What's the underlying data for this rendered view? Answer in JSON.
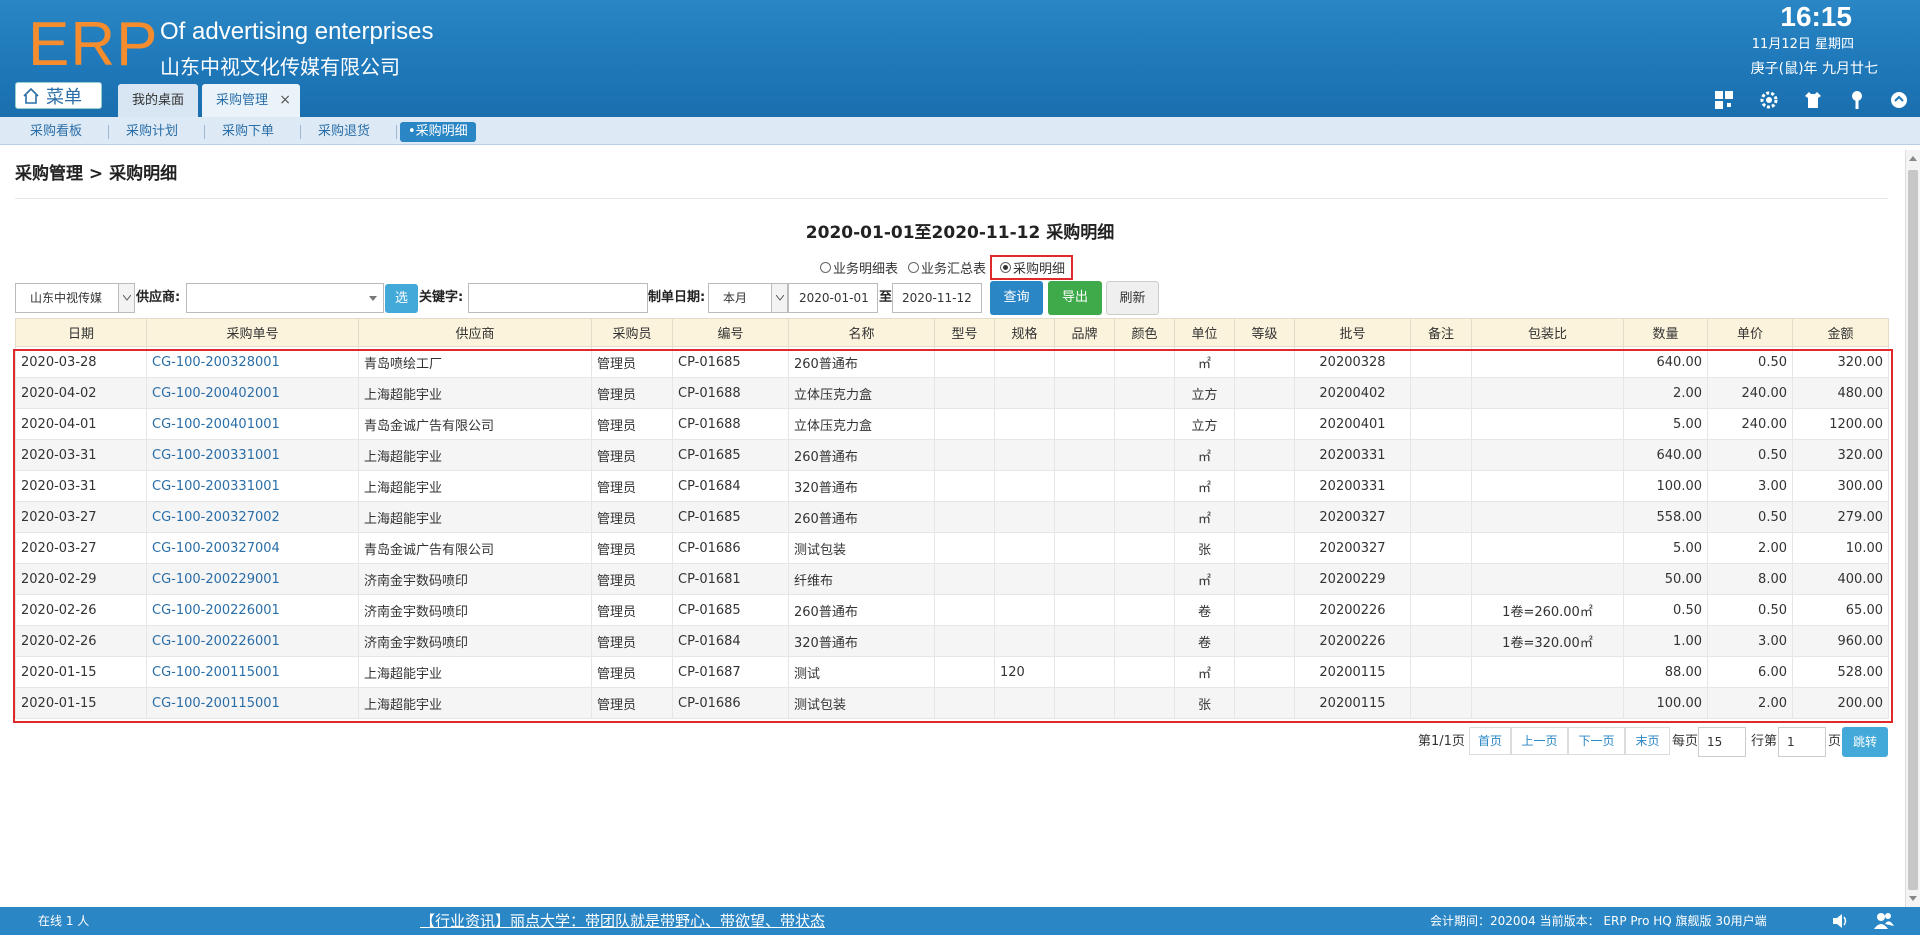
{
  "header": {
    "logo": "ERP",
    "company_en": "Of advertising enterprises",
    "company_cn": "山东中视文化传媒有限公司",
    "time": "16:15",
    "date": "11月12日 星期四",
    "lunar": "庚子(鼠)年 九月廿七",
    "menu_label": "菜单"
  },
  "tabs": [
    {
      "label": "我的桌面"
    },
    {
      "label": "采购管理",
      "close": "×"
    }
  ],
  "submenu": [
    "采购看板",
    "采购计划",
    "采购下单",
    "采购退货",
    "•采购明细"
  ],
  "breadcrumb": "采购管理 > 采购明细",
  "report_title": "2020-01-01至2020-11-12 采购明细",
  "report_types": [
    "业务明细表",
    "业务汇总表",
    "采购明细"
  ],
  "filters": {
    "company": "山东中视传媒",
    "supplier_label": "供应商:",
    "supplier_value": "",
    "choose_label": "选",
    "keyword_label": "关键字:",
    "keyword_value": "",
    "date_label": "制单日期:",
    "period": "本月",
    "date_from": "2020-01-01",
    "date_to_label": "至",
    "date_to": "2020-11-12",
    "query_label": "查询",
    "export_label": "导出",
    "refresh_label": "刷新"
  },
  "columns": [
    "日期",
    "采购单号",
    "供应商",
    "采购员",
    "编号",
    "名称",
    "型号",
    "规格",
    "品牌",
    "颜色",
    "单位",
    "等级",
    "批号",
    "备注",
    "包装比",
    "数量",
    "单价",
    "金额"
  ],
  "rows": [
    [
      "2020-03-28",
      "CG-100-200328001",
      "青岛喷绘工厂",
      "管理员",
      "CP-01685",
      "260普通布",
      "",
      "",
      "",
      "",
      "㎡",
      "",
      "20200328",
      "",
      "",
      "640.00",
      "0.50",
      "320.00"
    ],
    [
      "2020-04-02",
      "CG-100-200402001",
      "上海超能宇业",
      "管理员",
      "CP-01688",
      "立体压克力盒",
      "",
      "",
      "",
      "",
      "立方",
      "",
      "20200402",
      "",
      "",
      "2.00",
      "240.00",
      "480.00"
    ],
    [
      "2020-04-01",
      "CG-100-200401001",
      "青岛金诚广告有限公司",
      "管理员",
      "CP-01688",
      "立体压克力盒",
      "",
      "",
      "",
      "",
      "立方",
      "",
      "20200401",
      "",
      "",
      "5.00",
      "240.00",
      "1200.00"
    ],
    [
      "2020-03-31",
      "CG-100-200331001",
      "上海超能宇业",
      "管理员",
      "CP-01685",
      "260普通布",
      "",
      "",
      "",
      "",
      "㎡",
      "",
      "20200331",
      "",
      "",
      "640.00",
      "0.50",
      "320.00"
    ],
    [
      "2020-03-31",
      "CG-100-200331001",
      "上海超能宇业",
      "管理员",
      "CP-01684",
      "320普通布",
      "",
      "",
      "",
      "",
      "㎡",
      "",
      "20200331",
      "",
      "",
      "100.00",
      "3.00",
      "300.00"
    ],
    [
      "2020-03-27",
      "CG-100-200327002",
      "上海超能宇业",
      "管理员",
      "CP-01685",
      "260普通布",
      "",
      "",
      "",
      "",
      "㎡",
      "",
      "20200327",
      "",
      "",
      "558.00",
      "0.50",
      "279.00"
    ],
    [
      "2020-03-27",
      "CG-100-200327004",
      "青岛金诚广告有限公司",
      "管理员",
      "CP-01686",
      "测试包装",
      "",
      "",
      "",
      "",
      "张",
      "",
      "20200327",
      "",
      "",
      "5.00",
      "2.00",
      "10.00"
    ],
    [
      "2020-02-29",
      "CG-100-200229001",
      "济南金宇数码喷印",
      "管理员",
      "CP-01681",
      "纤维布",
      "",
      "",
      "",
      "",
      "㎡",
      "",
      "20200229",
      "",
      "",
      "50.00",
      "8.00",
      "400.00"
    ],
    [
      "2020-02-26",
      "CG-100-200226001",
      "济南金宇数码喷印",
      "管理员",
      "CP-01685",
      "260普通布",
      "",
      "",
      "",
      "",
      "卷",
      "",
      "20200226",
      "",
      "1卷=260.00㎡",
      "0.50",
      "0.50",
      "65.00"
    ],
    [
      "2020-02-26",
      "CG-100-200226001",
      "济南金宇数码喷印",
      "管理员",
      "CP-01684",
      "320普通布",
      "",
      "",
      "",
      "",
      "卷",
      "",
      "20200226",
      "",
      "1卷=320.00㎡",
      "1.00",
      "3.00",
      "960.00"
    ],
    [
      "2020-01-15",
      "CG-100-200115001",
      "上海超能宇业",
      "管理员",
      "CP-01687",
      "测试",
      "",
      "120",
      "",
      "",
      "㎡",
      "",
      "20200115",
      "",
      "",
      "88.00",
      "6.00",
      "528.00"
    ],
    [
      "2020-01-15",
      "CG-100-200115001",
      "上海超能宇业",
      "管理员",
      "CP-01686",
      "测试包装",
      "",
      "",
      "",
      "",
      "张",
      "",
      "20200115",
      "",
      "",
      "100.00",
      "2.00",
      "200.00"
    ]
  ],
  "pagination": {
    "page_info": "第1/1页",
    "first": "首页",
    "prev": "上一页",
    "next": "下一页",
    "last": "末页",
    "per_page_label": "每页",
    "per_page": "15",
    "rows_label": "行第",
    "page_input": "1",
    "page_label": "页",
    "go": "跳转"
  },
  "status": {
    "online": "在线  1  人",
    "news": "【行业资讯】丽点大学：带团队就是带野心、带欲望、带状态",
    "info": "会计期间：202004 当前版本： ERP Pro HQ 旗舰版 30用户端"
  }
}
